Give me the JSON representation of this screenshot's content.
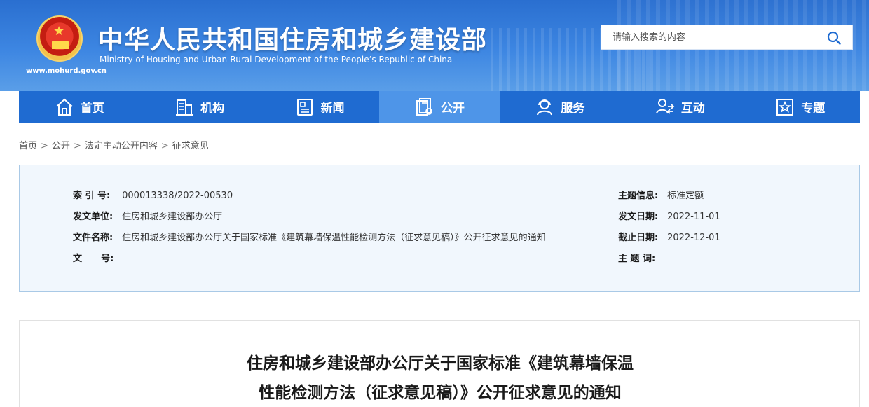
{
  "header": {
    "site_url": "www.mohurd.gov.cn",
    "title": "中华人民共和国住房和城乡建设部",
    "subtitle": "Ministry of Housing and Urban-Rural Development of the People’s Republic of China",
    "emblem_icon": "national-emblem-icon"
  },
  "search": {
    "placeholder": "请输入搜索的内容",
    "icon": "search-icon"
  },
  "nav": {
    "items": [
      {
        "label": "首页",
        "icon": "home-icon"
      },
      {
        "label": "机构",
        "icon": "building-icon"
      },
      {
        "label": "新闻",
        "icon": "news-icon"
      },
      {
        "label": "公开",
        "icon": "document-icon",
        "active": true
      },
      {
        "label": "服务",
        "icon": "service-icon"
      },
      {
        "label": "互动",
        "icon": "interaction-icon"
      },
      {
        "label": "专题",
        "icon": "topic-icon"
      }
    ]
  },
  "breadcrumb": {
    "items": [
      "首页",
      "公开",
      "法定主动公开内容",
      "征求意见"
    ],
    "separator": ">"
  },
  "info": {
    "index_label": "索 引 号:",
    "index_value": "000013338/2022-00530",
    "unit_label": "发文单位:",
    "unit_value": "住房和城乡建设部办公厅",
    "filename_label": "文件名称:",
    "filename_value": "住房和城乡建设部办公厅关于国家标准《建筑幕墙保温性能检测方法（征求意见稿）》公开征求意见的通知",
    "docno_label": "文      号:",
    "docno_value": "",
    "topic_label": "主题信息:",
    "topic_value": "标准定额",
    "date_label": "发文日期:",
    "date_value": "2022-11-01",
    "deadline_label": "截止日期:",
    "deadline_value": "2022-12-01",
    "keywords_label": "主 题 词:",
    "keywords_value": ""
  },
  "article": {
    "title_line1": "住房和城乡建设部办公厅关于国家标准《建筑幕墙保温",
    "title_line2": "性能检测方法（征求意见稿）》公开征求意见的通知"
  },
  "colors": {
    "nav_bg": "#1f6bd1",
    "nav_active": "#4e95e8",
    "info_bg": "#f1f7fd",
    "info_border": "#a9c9e6"
  }
}
